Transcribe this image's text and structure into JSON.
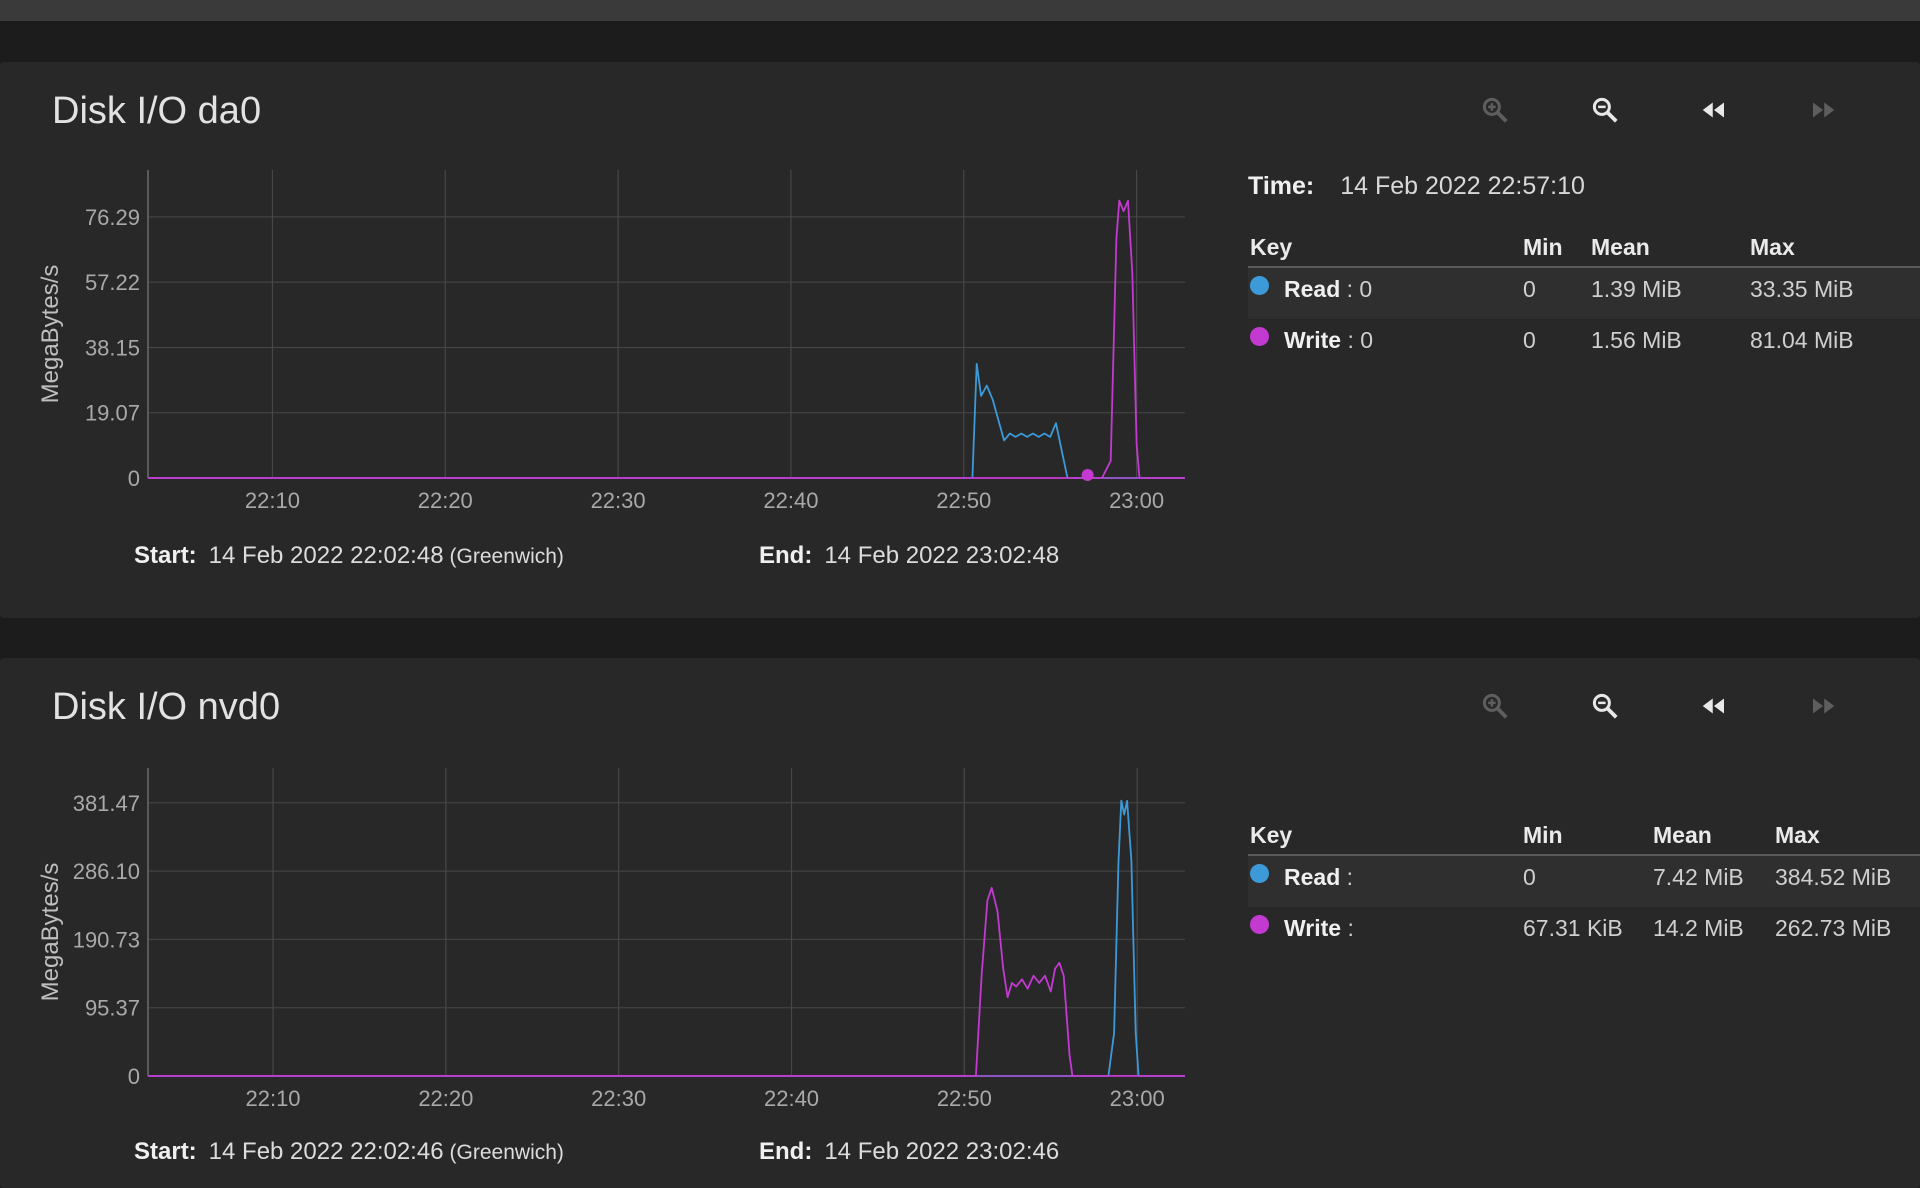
{
  "colors": {
    "read": "#3d9ad8",
    "write": "#c23ad0",
    "grid": "#474748",
    "axis": "#6a6a6a"
  },
  "icons": {
    "zoom_in": "zoom-in-icon",
    "zoom_out": "zoom-out-icon",
    "back": "rewind-icon",
    "forward": "fast-forward-icon"
  },
  "cards": [
    {
      "title": "Disk I/O da0",
      "start_label": "Start:",
      "start_value": "14 Feb 2022 22:02:48",
      "timezone": "(Greenwich)",
      "end_label": "End:",
      "end_value": "14 Feb 2022 23:02:48",
      "time_label": "Time:",
      "time_value": "14 Feb 2022 22:57:10",
      "legend": {
        "headers": [
          "Key",
          "Min",
          "Mean",
          "Max"
        ],
        "rows": [
          {
            "name": "Read",
            "suffix": " : 0",
            "min": "0",
            "mean": "1.39 MiB",
            "max": "33.35 MiB"
          },
          {
            "name": "Write",
            "suffix": " : 0",
            "min": "0",
            "mean": "1.56 MiB",
            "max": "81.04 MiB"
          }
        ]
      }
    },
    {
      "title": "Disk I/O nvd0",
      "start_label": "Start:",
      "start_value": "14 Feb 2022 22:02:46",
      "timezone": "(Greenwich)",
      "end_label": "End:",
      "end_value": "14 Feb 2022 23:02:46",
      "legend": {
        "headers": [
          "Key",
          "Min",
          "Mean",
          "Max"
        ],
        "rows": [
          {
            "name": "Read",
            "suffix": " :",
            "min": "0",
            "mean": "7.42 MiB",
            "max": "384.52 MiB"
          },
          {
            "name": "Write",
            "suffix": " :",
            "min": "67.31 KiB",
            "mean": "14.2 MiB",
            "max": "262.73 MiB"
          }
        ]
      }
    }
  ],
  "chart_data": [
    {
      "type": "line",
      "ylabel": "MegaBytes/s",
      "xlim": [
        "22:02:48",
        "23:02:48"
      ],
      "ylim": [
        0,
        90
      ],
      "yticks": [
        0,
        19.07,
        38.15,
        57.22,
        76.29
      ],
      "ytick_labels": [
        "0",
        "19.07",
        "38.15",
        "57.22",
        "76.29"
      ],
      "xticks": [
        "22:10",
        "22:20",
        "22:30",
        "22:40",
        "22:50",
        "23:00"
      ],
      "grid": true,
      "marker": {
        "series": "Write",
        "x": "22:57:10",
        "y": 0
      },
      "series": [
        {
          "name": "Read",
          "color": "#3d9ad8",
          "points": [
            [
              "22:02:48",
              0
            ],
            [
              "22:50:30",
              0
            ],
            [
              "22:50:45",
              33.35
            ],
            [
              "22:51:00",
              24
            ],
            [
              "22:51:20",
              27
            ],
            [
              "22:51:40",
              23
            ],
            [
              "22:52:00",
              17
            ],
            [
              "22:52:20",
              11
            ],
            [
              "22:52:40",
              13
            ],
            [
              "22:53:00",
              12
            ],
            [
              "22:53:20",
              13
            ],
            [
              "22:53:40",
              12
            ],
            [
              "22:54:00",
              13
            ],
            [
              "22:54:20",
              12
            ],
            [
              "22:54:40",
              13
            ],
            [
              "22:55:00",
              12
            ],
            [
              "22:55:20",
              16
            ],
            [
              "22:55:40",
              8
            ],
            [
              "22:56:00",
              0
            ],
            [
              "23:02:48",
              0
            ]
          ]
        },
        {
          "name": "Write",
          "color": "#c23ad0",
          "points": [
            [
              "22:02:48",
              0
            ],
            [
              "22:58:00",
              0
            ],
            [
              "22:58:30",
              5
            ],
            [
              "22:58:50",
              70
            ],
            [
              "22:59:00",
              81.04
            ],
            [
              "22:59:15",
              78
            ],
            [
              "22:59:30",
              81
            ],
            [
              "22:59:45",
              60
            ],
            [
              "23:00:00",
              10
            ],
            [
              "23:00:10",
              0
            ],
            [
              "23:02:48",
              0
            ]
          ]
        }
      ]
    },
    {
      "type": "line",
      "ylabel": "MegaBytes/s",
      "xlim": [
        "22:02:46",
        "23:02:46"
      ],
      "ylim": [
        0,
        430
      ],
      "yticks": [
        0,
        95.37,
        190.73,
        286.1,
        381.47
      ],
      "ytick_labels": [
        "0",
        "95.37",
        "190.73",
        "286.10",
        "381.47"
      ],
      "xticks": [
        "22:10",
        "22:20",
        "22:30",
        "22:40",
        "22:50",
        "23:00"
      ],
      "grid": true,
      "series": [
        {
          "name": "Read",
          "color": "#3d9ad8",
          "points": [
            [
              "22:02:46",
              0
            ],
            [
              "22:58:20",
              0
            ],
            [
              "22:58:40",
              60
            ],
            [
              "22:58:55",
              300
            ],
            [
              "22:59:05",
              384.52
            ],
            [
              "22:59:15",
              365
            ],
            [
              "22:59:25",
              384
            ],
            [
              "22:59:40",
              300
            ],
            [
              "22:59:55",
              60
            ],
            [
              "23:00:05",
              0
            ],
            [
              "23:02:46",
              0
            ]
          ]
        },
        {
          "name": "Write",
          "color": "#c23ad0",
          "points": [
            [
              "22:02:46",
              0.07
            ],
            [
              "22:50:40",
              0.07
            ],
            [
              "22:51:00",
              140
            ],
            [
              "22:51:20",
              245
            ],
            [
              "22:51:35",
              262.73
            ],
            [
              "22:51:55",
              230
            ],
            [
              "22:52:15",
              150
            ],
            [
              "22:52:30",
              110
            ],
            [
              "22:52:45",
              130
            ],
            [
              "22:53:00",
              125
            ],
            [
              "22:53:20",
              135
            ],
            [
              "22:53:40",
              122
            ],
            [
              "22:54:00",
              140
            ],
            [
              "22:54:20",
              130
            ],
            [
              "22:54:40",
              140
            ],
            [
              "22:55:00",
              118
            ],
            [
              "22:55:15",
              150
            ],
            [
              "22:55:30",
              158
            ],
            [
              "22:55:45",
              140
            ],
            [
              "22:56:05",
              30
            ],
            [
              "22:56:15",
              0.07
            ],
            [
              "23:02:46",
              0.07
            ]
          ]
        }
      ]
    }
  ]
}
